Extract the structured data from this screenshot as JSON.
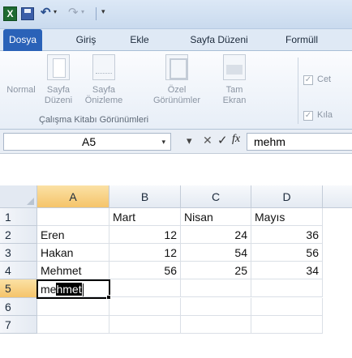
{
  "quick_access": {
    "logo_letter": "X"
  },
  "tabs": [
    "Dosya",
    "Giriş",
    "Ekle",
    "Sayfa Düzeni",
    "Formüll"
  ],
  "ribbon": {
    "buttons": [
      {
        "line1": "Normal",
        "line2": ""
      },
      {
        "line1": "Sayfa",
        "line2": "Düzeni"
      },
      {
        "line1": "Sayfa",
        "line2": "Önizleme"
      },
      {
        "line1": "Özel",
        "line2": "Görünümler"
      },
      {
        "line1": "Tam",
        "line2": "Ekran"
      }
    ],
    "group_label": "Çalışma Kitabı Görünümleri",
    "checkboxes": [
      {
        "label": "Cet",
        "checked": "✓"
      },
      {
        "label": "Kıla",
        "checked": "✓"
      }
    ]
  },
  "formula_bar": {
    "name_box": "A5",
    "name_box_arrow": "▾",
    "insert_fn_arrow": "▾",
    "cancel": "✕",
    "enter": "✓",
    "fx": "fx",
    "content": "mehm"
  },
  "grid": {
    "columns": [
      "A",
      "B",
      "C",
      "D"
    ],
    "rows": [
      {
        "num": "1",
        "cells": [
          "",
          "Mart",
          "Nisan",
          "Mayıs"
        ]
      },
      {
        "num": "2",
        "cells": [
          "Eren",
          "12",
          "24",
          "36"
        ]
      },
      {
        "num": "3",
        "cells": [
          "Hakan",
          "12",
          "54",
          "56"
        ]
      },
      {
        "num": "4",
        "cells": [
          "Mehmet",
          "56",
          "25",
          "34"
        ]
      },
      {
        "num": "5",
        "cells": [
          "",
          "",
          "",
          ""
        ]
      },
      {
        "num": "6",
        "cells": [
          "",
          "",
          "",
          ""
        ]
      },
      {
        "num": "7",
        "cells": [
          "",
          "",
          "",
          ""
        ]
      }
    ],
    "editing": {
      "typed": "me",
      "autocomplete": "hmet"
    }
  }
}
